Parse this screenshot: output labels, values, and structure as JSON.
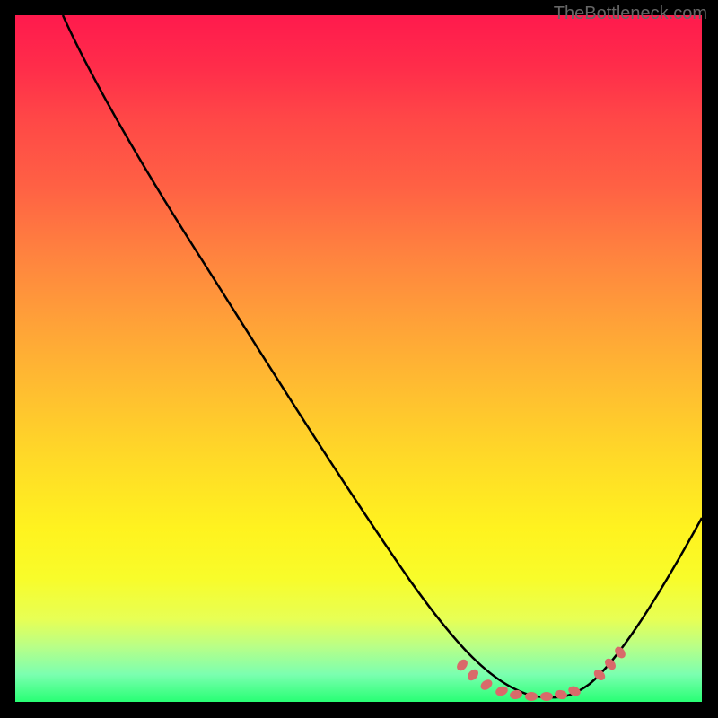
{
  "attribution": "TheBottleneck.com",
  "chart_data": {
    "type": "line",
    "title": "",
    "xlabel": "",
    "ylabel": "",
    "xlim": [
      0,
      100
    ],
    "ylim": [
      0,
      100
    ],
    "series": [
      {
        "name": "curve",
        "x": [
          7,
          15,
          25,
          35,
          45,
          55,
          65,
          70,
          73,
          75,
          78,
          80,
          82,
          85,
          90,
          95,
          100
        ],
        "values": [
          100,
          88,
          74,
          60,
          46,
          32,
          18,
          10,
          5,
          2,
          0.5,
          0,
          0.5,
          1.5,
          7,
          17,
          31
        ]
      }
    ],
    "annotations": {
      "dots_x": [
        65,
        68,
        71,
        73,
        75,
        77,
        79,
        81,
        83,
        85,
        86,
        87
      ],
      "dots_y": [
        5,
        3,
        1.5,
        1,
        0.5,
        0.3,
        0.3,
        0.5,
        1,
        3,
        4.5,
        6
      ]
    },
    "gradient_stops": [
      {
        "pos": 0,
        "color": "#ff1a4d"
      },
      {
        "pos": 25,
        "color": "#ff6144"
      },
      {
        "pos": 50,
        "color": "#ffb033"
      },
      {
        "pos": 75,
        "color": "#fff31f"
      },
      {
        "pos": 100,
        "color": "#28ff74"
      }
    ]
  }
}
